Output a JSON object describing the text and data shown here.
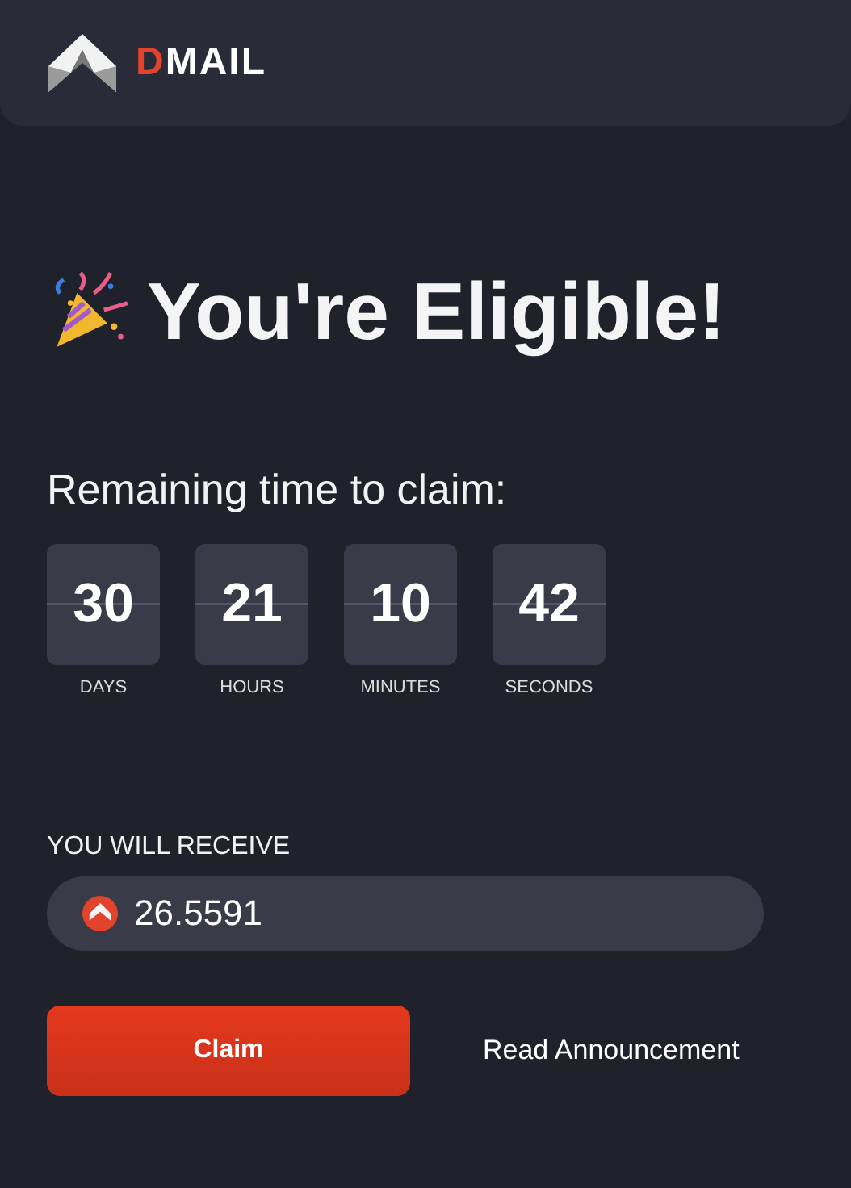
{
  "header": {
    "logo": {
      "accent": "D",
      "rest": "MAIL"
    }
  },
  "title": "You're Eligible!",
  "countdown": {
    "label": "Remaining time to claim:",
    "units": [
      {
        "value": "30",
        "unit": "DAYS"
      },
      {
        "value": "21",
        "unit": "HOURS"
      },
      {
        "value": "10",
        "unit": "MINUTES"
      },
      {
        "value": "42",
        "unit": "SECONDS"
      }
    ]
  },
  "receive": {
    "label": "YOU WILL RECEIVE",
    "amount": "26.5591"
  },
  "buttons": [
    {
      "kind": "primary",
      "label": "Claim"
    },
    {
      "kind": "link",
      "label": "Read Announcement"
    }
  ]
}
